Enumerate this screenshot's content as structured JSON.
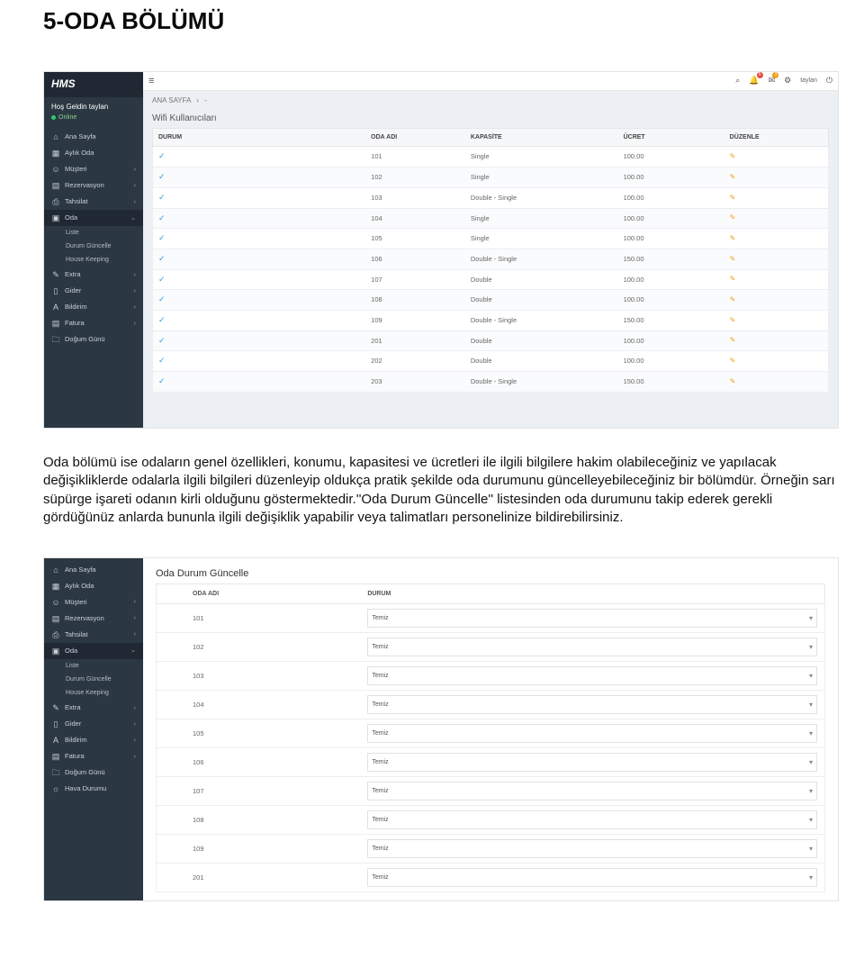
{
  "doc": {
    "title": "5-ODA BÖLÜMÜ",
    "body": "Oda bölümü ise odaların genel özellikleri, konumu, kapasitesi ve ücretleri ile ilgili bilgilere hakim olabileceğiniz ve yapılacak değişikliklerde odalarla ilgili bilgileri düzenleyip oldukça pratik şekilde oda durumunu güncelleyebileceğiniz bir bölümdür. Örneğin sarı süpürge işareti odanın kirli olduğunu göstermektedir.''Oda Durum Güncelle'' listesinden oda durumunu takip ederek gerekli gördüğünüz anlarda bununla ilgili değişiklik yapabilir veya talimatları personelinize bildirebilirsiniz."
  },
  "app": {
    "brand": "HMS",
    "welcome": "Hoş Geldin taylan",
    "online": "Online",
    "user": "taylan",
    "notif1": "5",
    "notif2": "3"
  },
  "nav": {
    "anaSayfa": "Ana Sayfa",
    "aylikOda": "Aylık Oda",
    "musteri": "Müşteri",
    "rezervasyon": "Rezervasyon",
    "tahsilat": "Tahsilat",
    "oda": "Oda",
    "liste": "Liste",
    "durumGuncelle": "Durum Güncelle",
    "houseKeeping": "House Keeping",
    "extra": "Extra",
    "gider": "Gider",
    "bildirim": "Bildirim",
    "fatura": "Fatura",
    "dogumGunu": "Doğum Günü",
    "havaDurumu": "Hava Durumu"
  },
  "crumb1": {
    "a": "ANA SAYFA",
    "sep": "›",
    "b": "-"
  },
  "table1": {
    "title": "Wifi Kullanıcıları",
    "headers": {
      "durum": "DURUM",
      "oda": "ODA ADI",
      "kap": "KAPASİTE",
      "ucret": "ÜCRET",
      "duz": "DÜZENLE"
    },
    "rows": [
      {
        "oda": "101",
        "kap": "Single",
        "ucret": "100.00"
      },
      {
        "oda": "102",
        "kap": "Single",
        "ucret": "100.00"
      },
      {
        "oda": "103",
        "kap": "Double - Single",
        "ucret": "100.00"
      },
      {
        "oda": "104",
        "kap": "Single",
        "ucret": "100.00"
      },
      {
        "oda": "105",
        "kap": "Single",
        "ucret": "100.00"
      },
      {
        "oda": "106",
        "kap": "Double - Single",
        "ucret": "150.00"
      },
      {
        "oda": "107",
        "kap": "Double",
        "ucret": "100.00"
      },
      {
        "oda": "108",
        "kap": "Double",
        "ucret": "100.00"
      },
      {
        "oda": "109",
        "kap": "Double - Single",
        "ucret": "150.00"
      },
      {
        "oda": "201",
        "kap": "Double",
        "ucret": "100.00"
      },
      {
        "oda": "202",
        "kap": "Double",
        "ucret": "100.00"
      },
      {
        "oda": "203",
        "kap": "Double - Single",
        "ucret": "150.00"
      }
    ]
  },
  "table2": {
    "title": "Oda Durum Güncelle",
    "headers": {
      "oda": "ODA ADI",
      "durum": "DURUM"
    },
    "value": "Temiz",
    "rows": [
      {
        "oda": "101"
      },
      {
        "oda": "102"
      },
      {
        "oda": "103"
      },
      {
        "oda": "104"
      },
      {
        "oda": "105"
      },
      {
        "oda": "106"
      },
      {
        "oda": "107"
      },
      {
        "oda": "108"
      },
      {
        "oda": "109"
      },
      {
        "oda": "201"
      }
    ]
  }
}
